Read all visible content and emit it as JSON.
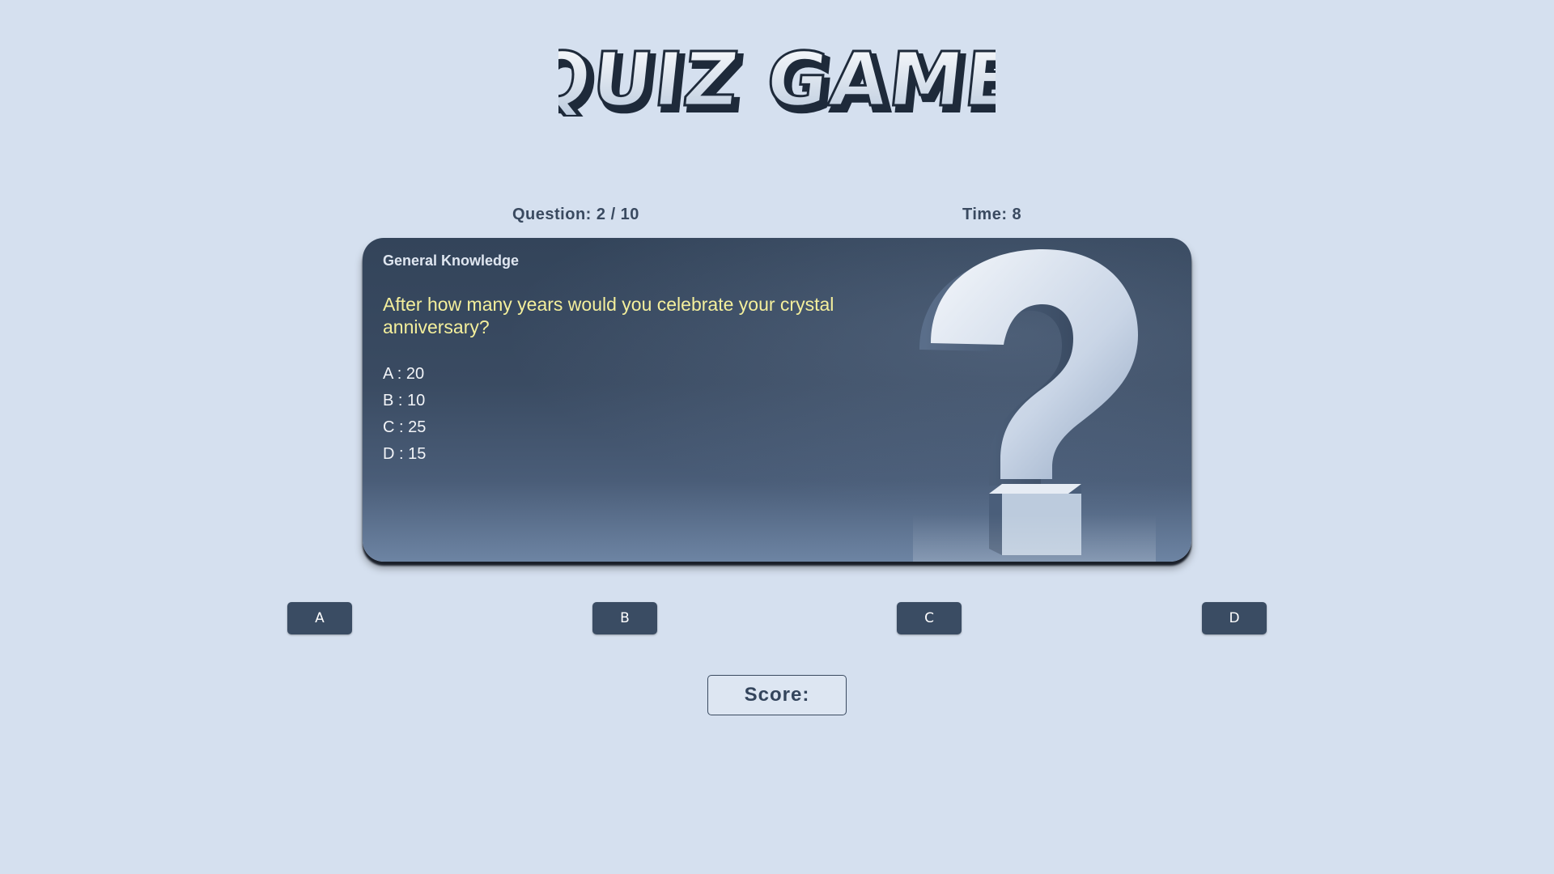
{
  "logo": {
    "text": "QUIZ GAME"
  },
  "status": {
    "question_counter": "Question: 2 / 10",
    "timer": "Time: 8"
  },
  "card": {
    "category": "General Knowledge",
    "question": "After how many years would you celebrate your crystal anniversary?",
    "options": [
      "A : 20",
      "B : 10",
      "C : 25",
      "D : 15"
    ],
    "illustration": "question-mark-3d"
  },
  "answer_buttons": [
    "A",
    "B",
    "C",
    "D"
  ],
  "score": {
    "label": "Score:"
  },
  "colors": {
    "background": "#d5e0ef",
    "card": "#3a4b62",
    "question_text": "#f4ef9c",
    "button": "#3a4c63",
    "text_dark": "#3a4a60"
  }
}
